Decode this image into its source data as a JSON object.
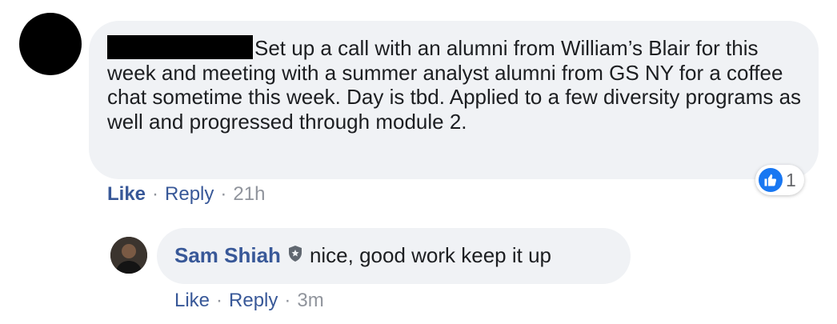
{
  "comment": {
    "author_redacted": true,
    "text": "Set up a call with an alumni from William’s Blair for this week and meeting with a summer analyst alumni from GS NY for a coffee chat sometime this week. Day is tbd. Applied to a few diversity programs as well and progressed through module 2.",
    "reaction_icon": "like-icon",
    "reaction_count": "1",
    "actions": {
      "like": "Like",
      "reply": "Reply",
      "time": "21h"
    }
  },
  "reply": {
    "author": "Sam Shiah",
    "badge_icon": "shield-icon",
    "text": "nice, good work keep it up",
    "actions": {
      "like": "Like",
      "reply": "Reply",
      "time": "3m"
    }
  },
  "colors": {
    "link": "#385898",
    "like_blue": "#1877f2",
    "bubble": "#f0f2f5",
    "muted": "#90949c"
  }
}
